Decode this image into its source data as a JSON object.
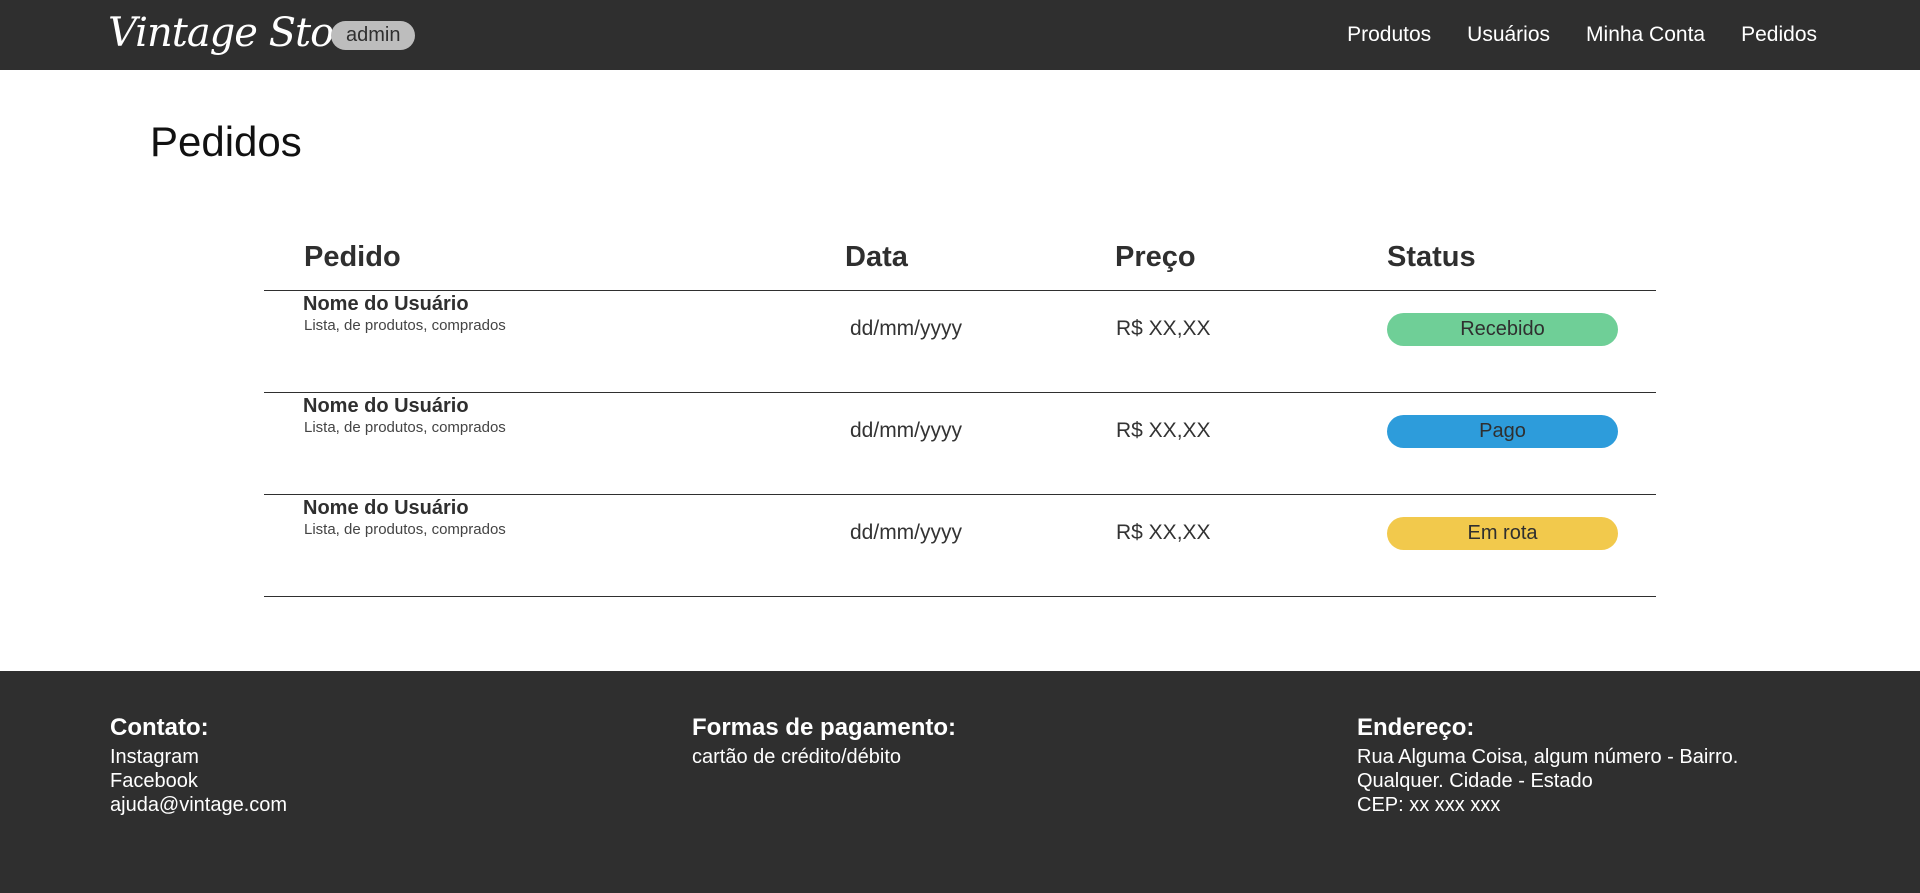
{
  "header": {
    "logo": "Vintage Store",
    "badge": "admin",
    "nav": [
      "Produtos",
      "Usuários",
      "Minha Conta",
      "Pedidos"
    ]
  },
  "page_title": "Pedidos",
  "table": {
    "columns": [
      "Pedido",
      "Data",
      "Preço",
      "Status"
    ],
    "rows": [
      {
        "user": "Nome do Usuário",
        "products": "Lista, de produtos, comprados",
        "date": "dd/mm/yyyy",
        "price": "R$ XX,XX",
        "status": "Recebido",
        "status_color": "#6fcf97"
      },
      {
        "user": "Nome do Usuário",
        "products": "Lista, de produtos, comprados",
        "date": "dd/mm/yyyy",
        "price": "R$ XX,XX",
        "status": "Pago",
        "status_color": "#2d9cdb"
      },
      {
        "user": "Nome do Usuário",
        "products": "Lista, de produtos, comprados",
        "date": "dd/mm/yyyy",
        "price": "R$ XX,XX",
        "status": "Em rota",
        "status_color": "#f2c94c"
      }
    ]
  },
  "footer": {
    "contact": {
      "heading": "Contato:",
      "lines": [
        "Instagram",
        "Facebook",
        "ajuda@vintage.com"
      ]
    },
    "payment": {
      "heading": "Formas de pagamento:",
      "lines": [
        "cartão de crédito/débito"
      ]
    },
    "address": {
      "heading": "Endereço:",
      "lines": [
        "Rua Alguma Coisa, algum número - Bairro.",
        "Qualquer. Cidade - Estado",
        "CEP: xx xxx xxx"
      ]
    }
  },
  "colors": {
    "dark": "#2f2f2f",
    "badge_bg": "#bdbdbd"
  }
}
